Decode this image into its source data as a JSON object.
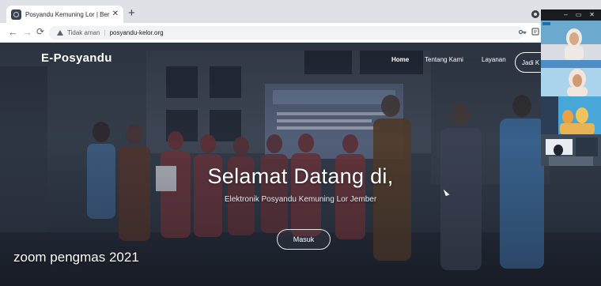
{
  "browser": {
    "tab_title": "Posyandu Kemuning Lor | Beranda",
    "tab_close_glyph": "✕",
    "new_tab_glyph": "+",
    "back_glyph": "←",
    "forward_glyph": "→",
    "reload_glyph": "⟳",
    "security_label": "Tidak aman",
    "separator": "|",
    "url": "posyandu-kelor.org"
  },
  "site": {
    "brand": "E-Posyandu",
    "nav": {
      "home": "Home",
      "about": "Tentang Kami",
      "services": "Layanan",
      "cta": "Jadi K"
    },
    "hero": {
      "title": "Selamat Datang di,",
      "subtitle": "Elektronik Posyandu Kemuning Lor Jember",
      "button": "Masuk"
    }
  },
  "overlay": {
    "caption": "zoom pengmas 2021"
  },
  "zoom_window": {
    "minimize_glyph": "–",
    "maximize_glyph": "▭",
    "close_glyph": "✕"
  },
  "colors": {
    "chrome_tabstrip": "#dee1e6",
    "hero_overlay": "#121620",
    "text_white": "#ffffff"
  }
}
